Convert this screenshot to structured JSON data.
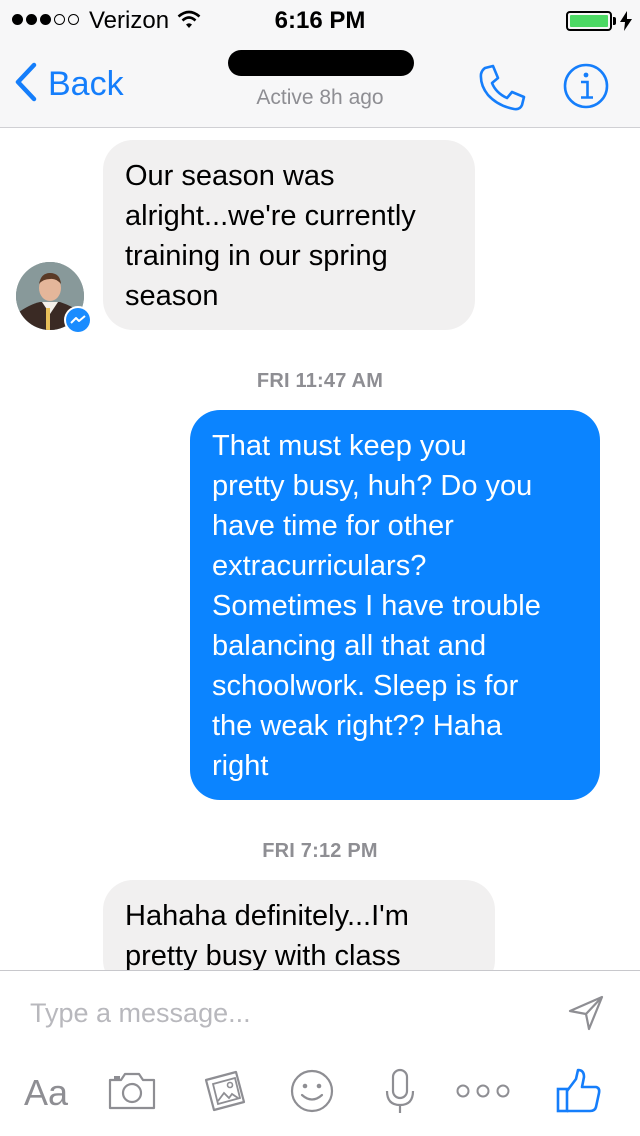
{
  "status_bar": {
    "carrier": "Verizon",
    "time": "6:16 PM",
    "signal_bars_filled": 3,
    "signal_bars_total": 5,
    "battery_level": 1.0
  },
  "nav": {
    "back_label": "Back",
    "active_status": "Active 8h ago"
  },
  "messages": [
    {
      "direction": "received",
      "lines": [
        "Our season was",
        "alright...we're currently",
        "training in our spring",
        "season"
      ]
    },
    {
      "timestamp": "FRI 11:47 AM"
    },
    {
      "direction": "sent",
      "lines": [
        "That must keep you",
        "pretty busy, huh? Do you",
        "have time for other",
        "extracurriculars?",
        "Sometimes I have trouble",
        "balancing all that and",
        "schoolwork. Sleep is for",
        "the weak right?? Haha",
        "right"
      ]
    },
    {
      "timestamp": "FRI 7:12 PM"
    },
    {
      "direction": "received",
      "lines": [
        "Hahaha definitely...I'm",
        "pretty busy with class"
      ]
    }
  ],
  "composer": {
    "placeholder": "Type a message...",
    "font_button_label": "Aa"
  },
  "colors": {
    "accent": "#157efb",
    "sent_bubble": "#0b84ff",
    "received_bubble": "#f1f0f0",
    "battery": "#4cd964"
  },
  "icons": {
    "back": "chevron-left-icon",
    "call": "phone-icon",
    "info": "info-icon",
    "send": "send-icon",
    "camera": "camera-icon",
    "gallery": "photo-gallery-icon",
    "emoji": "emoji-icon",
    "mic": "microphone-icon",
    "more": "more-icon",
    "like": "thumbs-up-icon"
  }
}
